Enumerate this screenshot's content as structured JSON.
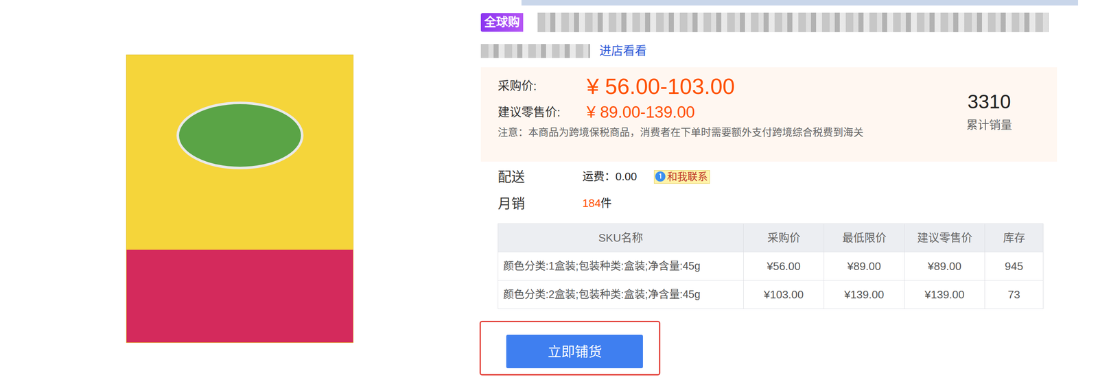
{
  "badge": "全球购",
  "store_link": "进店看看",
  "price_panel": {
    "purchase_label": "采购价:",
    "purchase_price": "¥ 56.00-103.00",
    "retail_label": "建议零售价:",
    "retail_price": "¥ 89.00-139.00",
    "notice": "注意：本商品为跨境保税商品，消费者在下单时需要额外支付跨境综合税费到海关",
    "sales_count": "3310",
    "sales_label": "累计销量"
  },
  "delivery": {
    "label": "配送",
    "shipping": "运费：0.00",
    "contact": "和我联系"
  },
  "monthly": {
    "label": "月销",
    "count": "184",
    "unit": "件"
  },
  "table": {
    "columns": [
      "SKU名称",
      "采购价",
      "最低限价",
      "建议零售价",
      "库存"
    ],
    "rows": [
      [
        "颜色分类:1盒装;包装种类:盒装;净含量:45g",
        "¥56.00",
        "¥89.00",
        "¥89.00",
        "945"
      ],
      [
        "颜色分类:2盒装;包装种类:盒装;净含量:45g",
        "¥103.00",
        "¥139.00",
        "¥139.00",
        "73"
      ]
    ]
  },
  "button": "立即铺货"
}
